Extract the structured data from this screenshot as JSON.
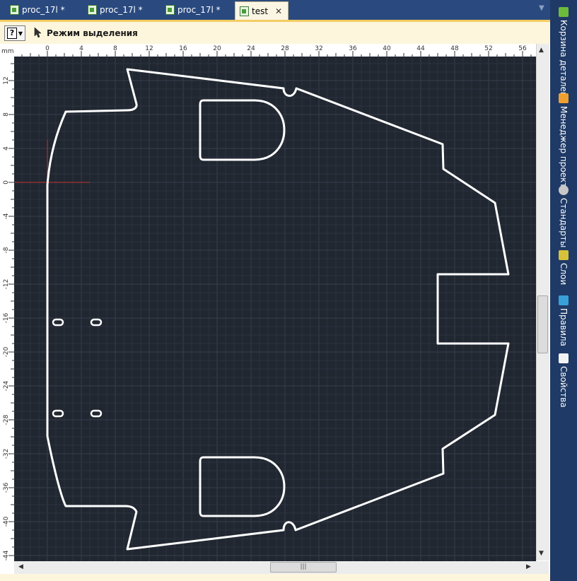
{
  "tabs": [
    {
      "label": "proc_17l *",
      "active": false
    },
    {
      "label": "proc_17l *",
      "active": false
    },
    {
      "label": "proc_17l *",
      "active": false
    },
    {
      "label": "test",
      "active": true
    }
  ],
  "tab_close_glyph": "✕",
  "toolbar": {
    "mode_label": "Режим выделения",
    "help_glyph": "?"
  },
  "ruler": {
    "unit": "mm",
    "x_ticks": [
      "0",
      "4",
      "8",
      "12",
      "16",
      "20",
      "24",
      "28",
      "32",
      "36",
      "40",
      "44",
      "48",
      "52",
      "56"
    ],
    "y_ticks": [
      "12",
      "8",
      "4",
      "0",
      "-4",
      "-8",
      "-12",
      "-16",
      "-20",
      "-24",
      "-28",
      "-32",
      "-36",
      "-40",
      "-44"
    ]
  },
  "side_panel": [
    {
      "label": "Корзина деталей",
      "icon": "basket-icon",
      "color": "#6dbb3c"
    },
    {
      "label": "Менеджер проекта",
      "icon": "project-manager-icon",
      "color": "#f0a030"
    },
    {
      "label": "Стандарты",
      "icon": "gear-icon",
      "color": "#c8c8c8"
    },
    {
      "label": "Слои",
      "icon": "layers-icon",
      "color": "#d6c23a"
    },
    {
      "label": "Правила",
      "icon": "rules-icon",
      "color": "#3aa0d8"
    },
    {
      "label": "Свойства",
      "icon": "properties-icon",
      "color": "#f3f3f3"
    }
  ],
  "colors": {
    "canvas_bg": "#212731",
    "outline": "#ffffff",
    "grid_minor": "#2c333f",
    "grid_major": "#363e4b",
    "origin_marker": "#c43434"
  },
  "scroll_thumb_glyph": "|||"
}
